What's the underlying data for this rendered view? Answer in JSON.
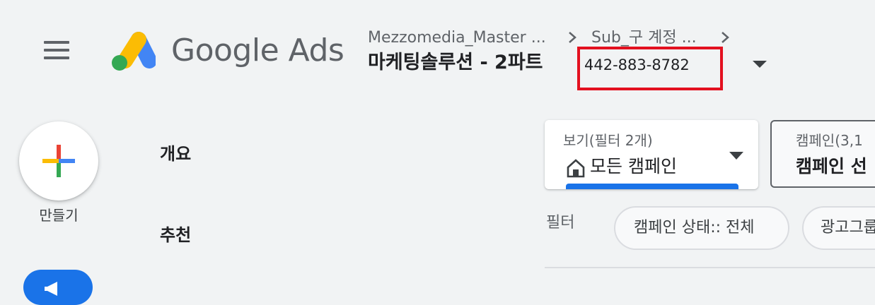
{
  "header": {
    "brand": "Google Ads",
    "breadcrumb": [
      "Mezzomedia_Master ...",
      "Sub_구 계정 ..."
    ],
    "account_name": "마케팅솔루션 - 2파트",
    "account_id": "442-883-8782",
    "highlight_color": "#e3101f"
  },
  "left_rail": {
    "create_label": "만들기",
    "nav": [
      "개요",
      "추천"
    ]
  },
  "view_selector": {
    "sublabel": "보기(필터 2개)",
    "value": "모든 캠페인",
    "icon": "home-icon"
  },
  "campaign_selector": {
    "sublabel": "캠페인(3,1",
    "value": "캠페인 선"
  },
  "filters": {
    "label": "필터",
    "chips": [
      "캠페인 상태:: 전체",
      "광고그룹"
    ]
  },
  "colors": {
    "accent": "#1a73e8",
    "background": "#f1f3f4"
  }
}
